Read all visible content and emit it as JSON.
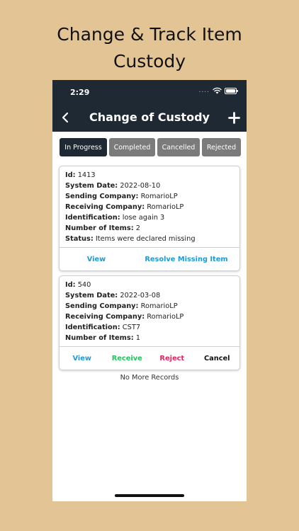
{
  "headline": {
    "line1": "Change & Track Item",
    "line2": "Custody"
  },
  "status_bar": {
    "time": "2:29",
    "signal": "....",
    "icons": [
      "wifi-icon",
      "battery-icon"
    ]
  },
  "nav": {
    "title": "Change of Custody",
    "back_icon": "chevron-left-icon",
    "add_icon": "plus-icon"
  },
  "tabs": [
    {
      "label": "In Progress",
      "active": true
    },
    {
      "label": "Completed",
      "active": false
    },
    {
      "label": "Cancelled",
      "active": false
    },
    {
      "label": "Rejected",
      "active": false
    }
  ],
  "records": [
    {
      "fields": [
        {
          "label": "Id:",
          "value": "1413"
        },
        {
          "label": "System Date:",
          "value": "2022-08-10"
        },
        {
          "label": "Sending Company:",
          "value": "RomarioLP"
        },
        {
          "label": "Receiving Company:",
          "value": "RomarioLP"
        },
        {
          "label": "Identification:",
          "value": "lose again 3"
        },
        {
          "label": "Number of Items:",
          "value": "2"
        },
        {
          "label": "Status:",
          "value": "Items were declared missing"
        }
      ],
      "actions": [
        "View",
        "Resolve Missing Item"
      ]
    },
    {
      "fields": [
        {
          "label": "Id:",
          "value": "540"
        },
        {
          "label": "System Date:",
          "value": "2022-03-08"
        },
        {
          "label": "Sending Company:",
          "value": "RomarioLP"
        },
        {
          "label": "Receiving Company:",
          "value": "RomarioLP"
        },
        {
          "label": "Identification:",
          "value": "CST7"
        },
        {
          "label": "Number of Items:",
          "value": "1"
        }
      ],
      "actions": [
        "View",
        "Receive",
        "Reject",
        "Cancel"
      ]
    }
  ],
  "footer_text": "No More Records",
  "colors": {
    "background": "#e2c495",
    "topbar": "#1f2933",
    "tab_active": "#1f2933",
    "tab_inactive": "#7b7b7b",
    "action_blue": "#1e9ad6",
    "action_green": "#22c55e",
    "action_pink": "#e0245e"
  }
}
